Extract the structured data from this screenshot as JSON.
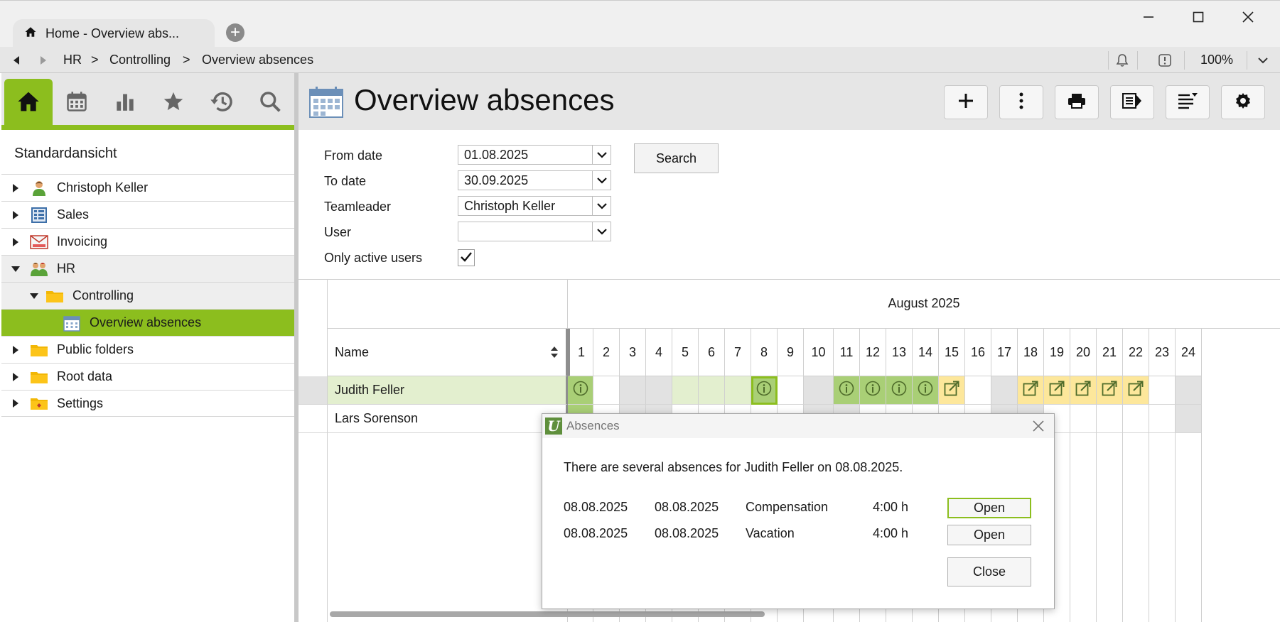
{
  "window": {
    "tab_title": "Home - Overview abs...",
    "new_tab_icon": "plus-circle-icon"
  },
  "breadcrumb": [
    "HR",
    ">",
    "Controlling",
    ">",
    "Overview absences"
  ],
  "zoom": "100%",
  "left": {
    "tabs": [
      "home-icon",
      "calendar-icon",
      "chart-icon",
      "star-icon",
      "history-icon",
      "search-icon"
    ],
    "view_title": "Standardansicht",
    "tree": [
      {
        "label": "Christoph Keller",
        "icon": "user-icon",
        "expanded": false,
        "level": 0
      },
      {
        "label": "Sales",
        "icon": "sales-icon",
        "expanded": false,
        "level": 0
      },
      {
        "label": "Invoicing",
        "icon": "invoice-icon",
        "expanded": false,
        "level": 0
      },
      {
        "label": "HR",
        "icon": "team-icon",
        "expanded": true,
        "level": 0
      },
      {
        "label": "Controlling",
        "icon": "folder-icon",
        "expanded": true,
        "level": 1
      },
      {
        "label": "Overview absences",
        "icon": "calendar-icon",
        "expanded": false,
        "level": 2
      },
      {
        "label": "Public folders",
        "icon": "folder-icon",
        "expanded": false,
        "level": 0
      },
      {
        "label": "Root data",
        "icon": "folder-icon",
        "expanded": false,
        "level": 0
      },
      {
        "label": "Settings",
        "icon": "settings-folder-icon",
        "expanded": false,
        "level": 0
      }
    ]
  },
  "main": {
    "title": "Overview absences",
    "toolbar": [
      "add-icon",
      "more-icon",
      "print-icon",
      "export-icon",
      "sort-icon",
      "settings-icon"
    ]
  },
  "filters": {
    "from_date_label": "From date",
    "from_date": "01.08.2025",
    "to_date_label": "To date",
    "to_date": "30.09.2025",
    "teamleader_label": "Teamleader",
    "teamleader": "Christoph Keller",
    "user_label": "User",
    "user": "",
    "only_active_label": "Only active users",
    "only_active": true,
    "search_label": "Search"
  },
  "grid": {
    "month": "August 2025",
    "name_header": "Name",
    "days": [
      "1",
      "2",
      "3",
      "4",
      "5",
      "6",
      "7",
      "8",
      "9",
      "10",
      "11",
      "12",
      "13",
      "14",
      "15",
      "16",
      "17",
      "18",
      "19",
      "20",
      "21",
      "22",
      "23",
      "24"
    ],
    "rows": [
      {
        "name": "Judith Feller"
      },
      {
        "name": "Lars Sorenson"
      }
    ]
  },
  "dialog": {
    "title": "Absences",
    "message": "There are several absences for Judith Feller on 08.08.2025.",
    "entries": [
      {
        "from": "08.08.2025",
        "to": "08.08.2025",
        "type": "Compensation",
        "hours": "4:00 h",
        "action": "Open"
      },
      {
        "from": "08.08.2025",
        "to": "08.08.2025",
        "type": "Vacation",
        "hours": "4:00 h",
        "action": "Open"
      }
    ],
    "close_label": "Close"
  },
  "colors": {
    "accent": "#8cbe1e",
    "absence_green": "#a9cf76",
    "absence_yellow": "#fde79b",
    "weekday_tint": "#e3efcf",
    "weekend": "#e2e2e2"
  }
}
